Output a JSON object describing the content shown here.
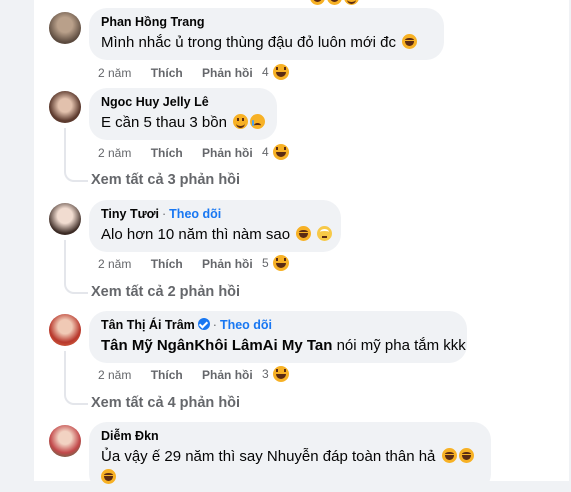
{
  "comments": [
    {
      "name": "Phan Hồng Trang",
      "follow": "",
      "text": "Mình nhắc ủ trong thùng đậu đỏ luôn mới đc",
      "time": "2 năm",
      "like": "Thích",
      "reply": "Phản hồi",
      "reaction_count": "4",
      "see_more": "",
      "avatar_color": "#7a6a5c"
    },
    {
      "name": "Ngoc Huy Jelly Lê",
      "follow": "",
      "text": "E cần 5 thau 3 bồn",
      "time": "2 năm",
      "like": "Thích",
      "reply": "Phản hồi",
      "reaction_count": "4",
      "see_more": "Xem tất cả 3 phản hồi",
      "avatar_color": "#8a5a48"
    },
    {
      "name": "Tiny Tươi",
      "follow": "Theo dõi",
      "text": "Alo hơn 10 năm thì nàm sao",
      "time": "2 năm",
      "like": "Thích",
      "reply": "Phản hồi",
      "reaction_count": "5",
      "see_more": "Xem tất cả 2 phản hồi",
      "avatar_color": "#c9b6a8"
    },
    {
      "name": "Tân Thị Ái Trâm",
      "follow": "Theo dõi",
      "tag": "Tân Mỹ NgânKhôi LâmAi My Tan",
      "text": " nói mỹ pha tắm kkk",
      "time": "2 năm",
      "like": "Thích",
      "reply": "Phản hồi",
      "reaction_count": "3",
      "see_more": "Xem tất cả 4 phản hồi",
      "avatar_color": "#b8382c"
    },
    {
      "name": "Diễm Đkn",
      "follow": "",
      "text": "Ủa vậy ế 29 năm thì say Nhuyễn đáp toàn thân hả",
      "avatar_color": "#c2484a"
    }
  ],
  "colors": {
    "accent": "#1877f2",
    "bubble": "#f0f2f5",
    "secondary_text": "#65676b"
  },
  "icons": [
    "laughing-emoji-icon",
    "crying-emoji-icon",
    "eyeroll-emoji-icon",
    "grinning-emoji-icon",
    "verified-badge-icon"
  ]
}
